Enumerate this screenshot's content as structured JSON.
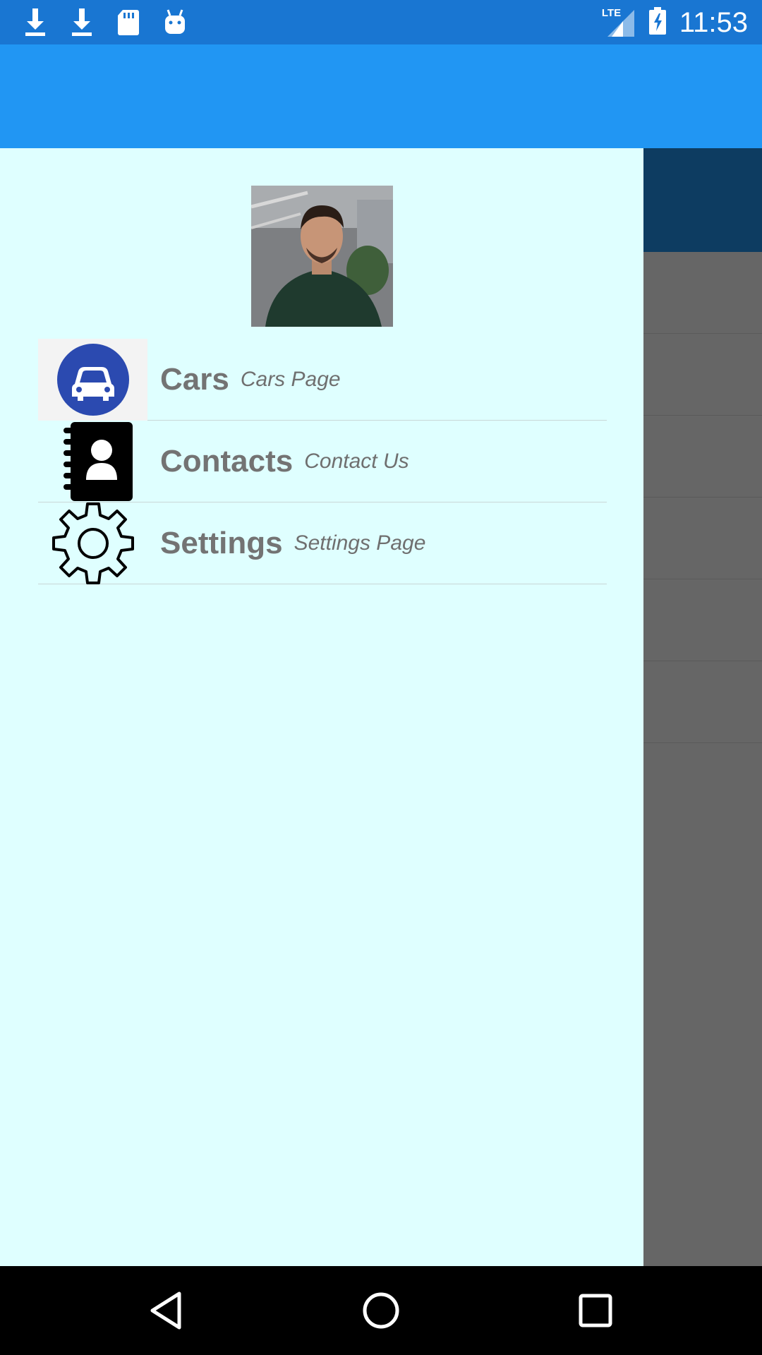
{
  "status_bar": {
    "time": "11:53",
    "network": "LTE",
    "left_icons": [
      "download-icon",
      "download-icon",
      "sd-card-icon",
      "android-icon"
    ],
    "right_icons": [
      "lte-signal-icon",
      "battery-charging-icon"
    ]
  },
  "drawer": {
    "avatar_alt": "profile-photo",
    "items": [
      {
        "title": "Cars",
        "subtitle": "Cars Page",
        "icon": "car-icon"
      },
      {
        "title": "Contacts",
        "subtitle": "Contact Us",
        "icon": "contacts-book-icon"
      },
      {
        "title": "Settings",
        "subtitle": "Settings Page",
        "icon": "gear-icon"
      }
    ]
  },
  "nav_bar": {
    "buttons": [
      "back-icon",
      "home-icon",
      "recents-icon"
    ]
  },
  "colors": {
    "status_bar": "#1976d2",
    "app_bar": "#2196f3",
    "drawer_bg": "#dfffff",
    "scrim": "#666666",
    "car_badge": "#2b4ab0"
  }
}
